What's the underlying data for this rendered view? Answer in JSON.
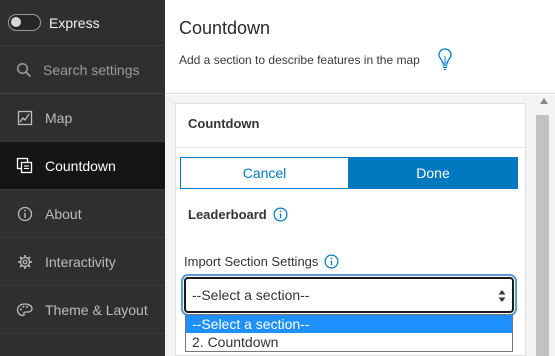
{
  "sidebar": {
    "express_label": "Express",
    "search_placeholder": "Search settings",
    "items": [
      {
        "label": "Map",
        "icon": "map-icon",
        "active": false
      },
      {
        "label": "Countdown",
        "icon": "countdown-icon",
        "active": true
      },
      {
        "label": "About",
        "icon": "info-icon",
        "active": false
      },
      {
        "label": "Interactivity",
        "icon": "gear-icon",
        "active": false
      },
      {
        "label": "Theme & Layout",
        "icon": "palette-icon",
        "active": false
      }
    ]
  },
  "header": {
    "title": "Countdown",
    "subtitle": "Add a section to describe features in the map"
  },
  "panel": {
    "title": "Countdown",
    "cancel_label": "Cancel",
    "done_label": "Done",
    "leaderboard_label": "Leaderboard",
    "import_label": "Import Section Settings",
    "select_value": "--Select a section--",
    "options": [
      "--Select a section--",
      "2. Countdown"
    ]
  },
  "colors": {
    "accent": "#0079c1",
    "sidebar_bg": "#2f2f2f",
    "sidebar_active_bg": "#151515",
    "option_highlight": "#1e90ff"
  }
}
